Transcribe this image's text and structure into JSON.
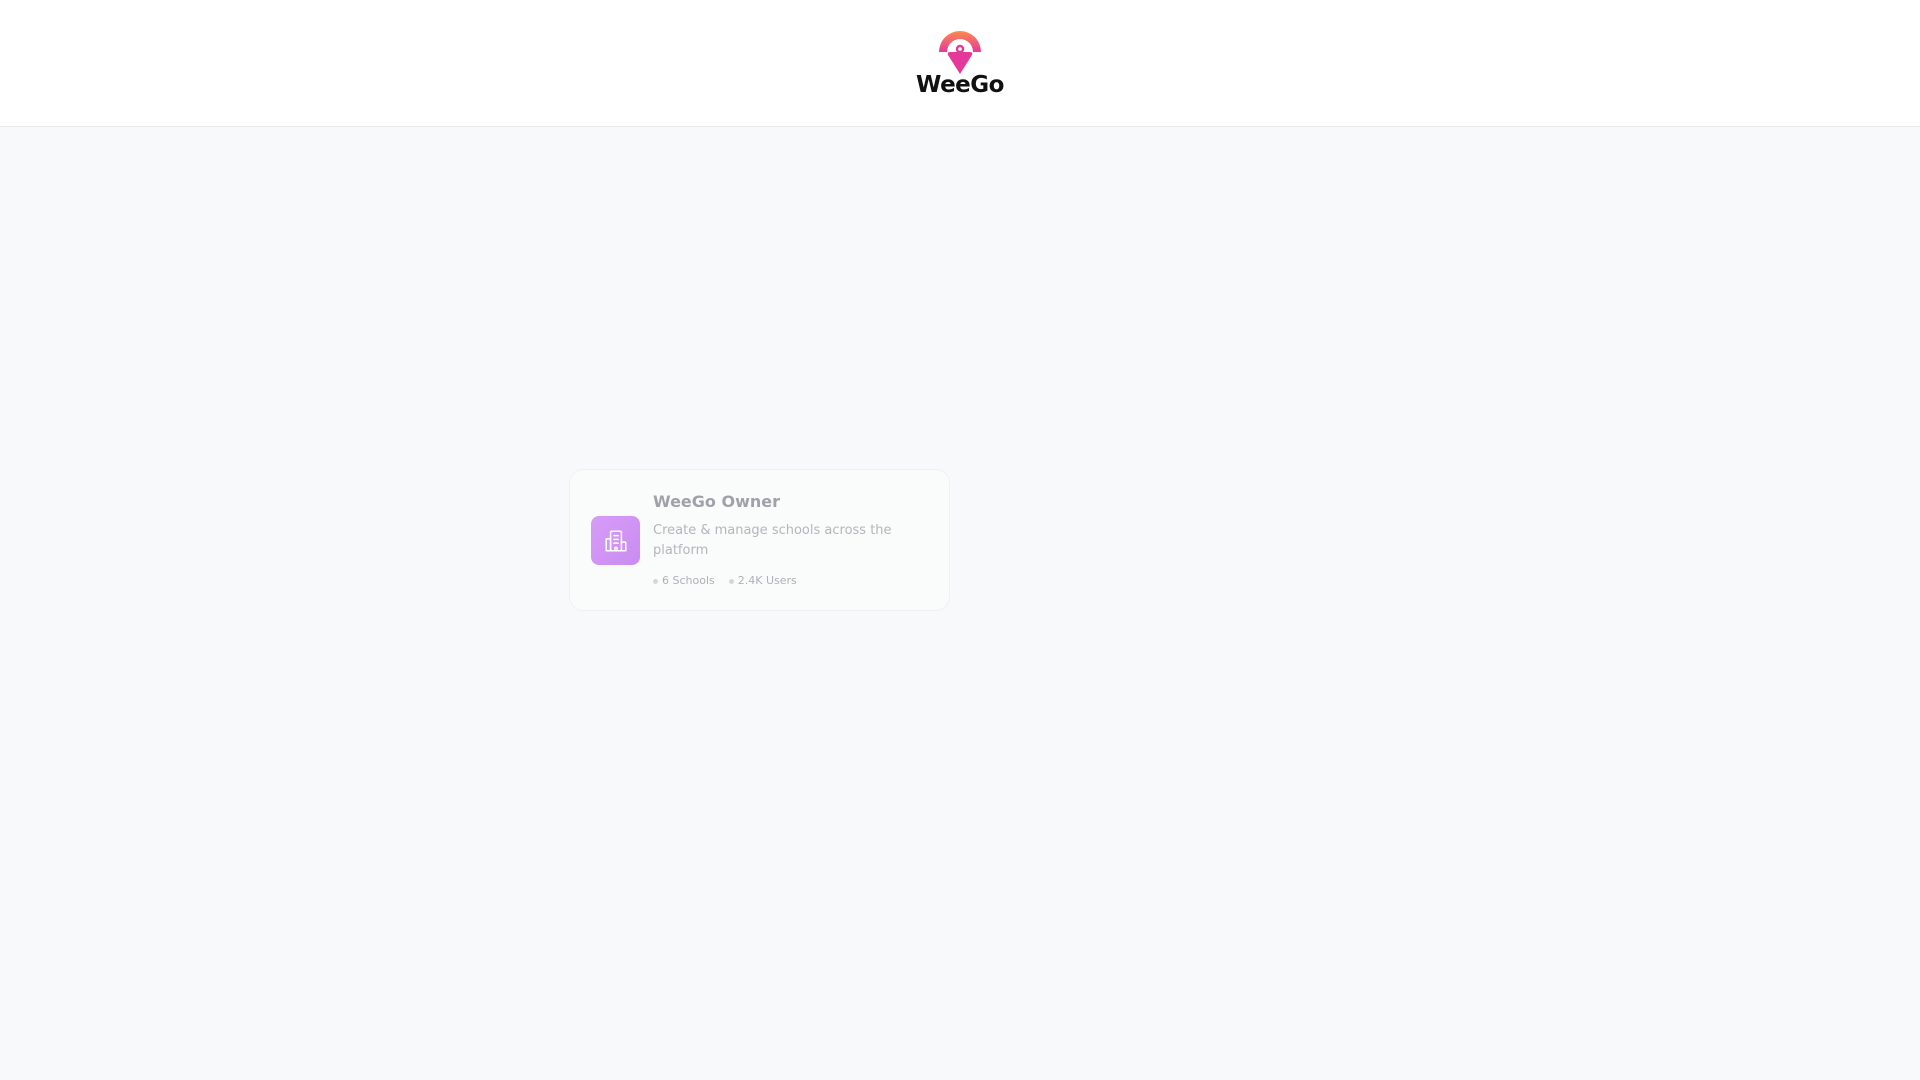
{
  "brand": {
    "name": "WeeGo",
    "logo_icon": "location-pin-icon",
    "colors": {
      "gradient_start": "#ff8a4c",
      "gradient_end": "#e5399a"
    }
  },
  "roles": [
    {
      "title": "WeeGo Owner",
      "description": "Create & manage schools across the platform",
      "icon": "building-icon",
      "icon_color": "#d79cf7",
      "stats": [
        "6 Schools",
        "2.4K Users"
      ]
    }
  ]
}
